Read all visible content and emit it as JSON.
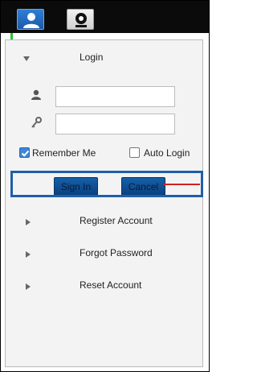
{
  "tabs": [
    {
      "icon": "user-icon",
      "active": true
    },
    {
      "icon": "camera-icon",
      "active": false
    }
  ],
  "login": {
    "title": "Login",
    "username_value": "",
    "password_value": "",
    "remember_label": "Remember Me",
    "remember_checked": true,
    "auto_login_label": "Auto Login",
    "auto_login_checked": false,
    "sign_in_label": "Sign In",
    "cancel_label": "Cancel"
  },
  "menu": {
    "items": [
      {
        "label": "Register Account"
      },
      {
        "label": "Forgot Password"
      },
      {
        "label": "Reset Account"
      }
    ]
  },
  "colors": {
    "topbar": "#0b0b0b",
    "accent": "#1f5fa8",
    "annotation": "#d22020"
  }
}
